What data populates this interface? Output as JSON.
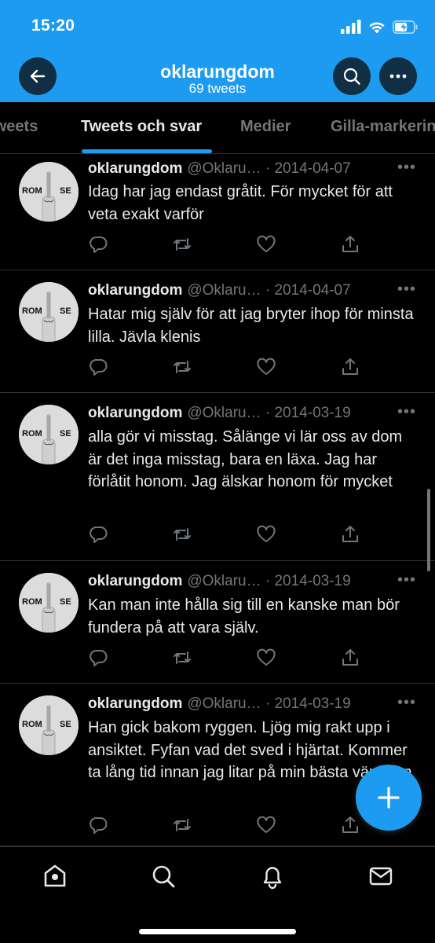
{
  "status": {
    "time": "15:20"
  },
  "header": {
    "title": "oklarungdom",
    "subtitle": "69 tweets"
  },
  "tabs": [
    {
      "label": "Tweets",
      "active": false
    },
    {
      "label": "Tweets och svar",
      "active": true
    },
    {
      "label": "Medier",
      "active": false
    },
    {
      "label": "Gilla-markeringar",
      "active": false
    }
  ],
  "avatar_text": {
    "left": "ROM",
    "right": "SE"
  },
  "tweets": [
    {
      "name": "oklarungdom",
      "meta": "@Oklaru… · 2014-04-07",
      "text": "Idag har jag endast gråtit. För mycket för att veta exakt varför"
    },
    {
      "name": "oklarungdom",
      "meta": "@Oklaru… · 2014-04-07",
      "text": "Hatar mig själv för att jag bryter ihop för minsta lilla. Jävla klenis"
    },
    {
      "name": "oklarungdom",
      "meta": "@Oklaru… · 2014-03-19",
      "text": "alla gör vi misstag. Sålänge vi lär oss av dom är det inga misstag, bara en läxa. Jag har förlåtit honom. Jag älskar honom för mycket"
    },
    {
      "name": "oklarungdom",
      "meta": "@Oklaru… · 2014-03-19",
      "text": "Kan man inte hålla sig till en kanske man bör fundera på att vara själv."
    },
    {
      "name": "oklarungdom",
      "meta": "@Oklaru… · 2014-03-19",
      "text": "Han gick bakom ryggen. Ljög mig rakt upp i ansiktet. Fyfan vad det sved i hjärtat. Kommer ta lång tid innan jag litar på min bästa vän igen"
    }
  ],
  "colors": {
    "accent": "#1d9bf0",
    "background": "#000000",
    "secondary_text": "#71767b",
    "divider": "#2f3336"
  },
  "icons": [
    "back-arrow-icon",
    "search-icon",
    "more-icon",
    "reply-icon",
    "retweet-icon",
    "like-icon",
    "share-icon",
    "compose-icon",
    "home-icon",
    "notifications-icon",
    "messages-icon"
  ]
}
